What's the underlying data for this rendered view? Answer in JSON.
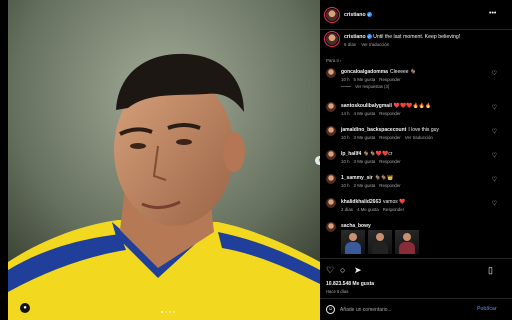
{
  "media": {
    "next_icon": "chevron-right-icon",
    "tag_icon": "person-tag-icon",
    "carousel_count": 4,
    "carousel_active": 1
  },
  "post": {
    "username": "cristiano",
    "more_label": "•••",
    "caption_user": "cristiano",
    "caption_text": "Until the last moment. Keep believing!",
    "caption_time": "6 días",
    "caption_translate": "Ver traducción",
    "translation_note": "Para ti ›"
  },
  "comments": [
    {
      "user": "goncaloalgadomma",
      "text": "Cleeeee 🐐",
      "time": "10 h",
      "likes": "5 Me gusta",
      "reply": "Responder",
      "replies": "Ver respuestas (3)"
    },
    {
      "user": "santoskoulibalygmail",
      "text": "❤️❤️❤️🔥🔥🔥",
      "time": "14 h",
      "likes": "4 Me gusta",
      "reply": "Responder"
    },
    {
      "user": "jamaldino_backspacecount",
      "text": "I love this guy",
      "time": "10 h",
      "likes": "3 Me gusta",
      "reply": "Responder",
      "translate": "Ver traducción"
    },
    {
      "user": "lp_hallf4",
      "text": "🐐🐐❤️❤️cr",
      "time": "10 h",
      "likes": "3 Me gusta",
      "reply": "Responder"
    },
    {
      "user": "1_sammy_sir",
      "text": "🐐🐐👑",
      "time": "10 h",
      "likes": "2 Me gusta",
      "reply": "Responder"
    },
    {
      "user": "khalidkhalid2663",
      "text": "vamos ❤️",
      "time": "2 días",
      "likes": "4 Me gusta",
      "reply": "Responder"
    },
    {
      "user": "sacha_bowy",
      "text": "",
      "time": "",
      "likes": "",
      "reply": ""
    }
  ],
  "actions": {
    "like_icon": "heart-icon",
    "comment_icon": "comment-icon",
    "share_icon": "share-icon",
    "save_icon": "bookmark-icon",
    "likes_count": "10.823.548 Me gusta",
    "posted_ago": "Hace 6 días"
  },
  "composer": {
    "emoji_icon": "emoji-icon",
    "placeholder": "Añade un comentario...",
    "publish_label": "Publicar"
  },
  "colors": {
    "accent": "#3897f0",
    "publish": "#4a6fa8",
    "kit_yellow": "#f2d81e",
    "kit_blue": "#1f3f9a"
  }
}
